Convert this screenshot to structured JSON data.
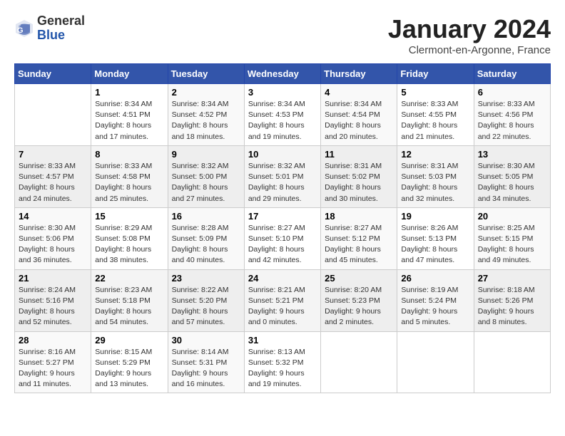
{
  "header": {
    "logo_general": "General",
    "logo_blue": "Blue",
    "month_title": "January 2024",
    "location": "Clermont-en-Argonne, France"
  },
  "weekdays": [
    "Sunday",
    "Monday",
    "Tuesday",
    "Wednesday",
    "Thursday",
    "Friday",
    "Saturday"
  ],
  "weeks": [
    [
      {
        "day": "",
        "sunrise": "",
        "sunset": "",
        "daylight": ""
      },
      {
        "day": "1",
        "sunrise": "Sunrise: 8:34 AM",
        "sunset": "Sunset: 4:51 PM",
        "daylight": "Daylight: 8 hours and 17 minutes."
      },
      {
        "day": "2",
        "sunrise": "Sunrise: 8:34 AM",
        "sunset": "Sunset: 4:52 PM",
        "daylight": "Daylight: 8 hours and 18 minutes."
      },
      {
        "day": "3",
        "sunrise": "Sunrise: 8:34 AM",
        "sunset": "Sunset: 4:53 PM",
        "daylight": "Daylight: 8 hours and 19 minutes."
      },
      {
        "day": "4",
        "sunrise": "Sunrise: 8:34 AM",
        "sunset": "Sunset: 4:54 PM",
        "daylight": "Daylight: 8 hours and 20 minutes."
      },
      {
        "day": "5",
        "sunrise": "Sunrise: 8:33 AM",
        "sunset": "Sunset: 4:55 PM",
        "daylight": "Daylight: 8 hours and 21 minutes."
      },
      {
        "day": "6",
        "sunrise": "Sunrise: 8:33 AM",
        "sunset": "Sunset: 4:56 PM",
        "daylight": "Daylight: 8 hours and 22 minutes."
      }
    ],
    [
      {
        "day": "7",
        "sunrise": "Sunrise: 8:33 AM",
        "sunset": "Sunset: 4:57 PM",
        "daylight": "Daylight: 8 hours and 24 minutes."
      },
      {
        "day": "8",
        "sunrise": "Sunrise: 8:33 AM",
        "sunset": "Sunset: 4:58 PM",
        "daylight": "Daylight: 8 hours and 25 minutes."
      },
      {
        "day": "9",
        "sunrise": "Sunrise: 8:32 AM",
        "sunset": "Sunset: 5:00 PM",
        "daylight": "Daylight: 8 hours and 27 minutes."
      },
      {
        "day": "10",
        "sunrise": "Sunrise: 8:32 AM",
        "sunset": "Sunset: 5:01 PM",
        "daylight": "Daylight: 8 hours and 29 minutes."
      },
      {
        "day": "11",
        "sunrise": "Sunrise: 8:31 AM",
        "sunset": "Sunset: 5:02 PM",
        "daylight": "Daylight: 8 hours and 30 minutes."
      },
      {
        "day": "12",
        "sunrise": "Sunrise: 8:31 AM",
        "sunset": "Sunset: 5:03 PM",
        "daylight": "Daylight: 8 hours and 32 minutes."
      },
      {
        "day": "13",
        "sunrise": "Sunrise: 8:30 AM",
        "sunset": "Sunset: 5:05 PM",
        "daylight": "Daylight: 8 hours and 34 minutes."
      }
    ],
    [
      {
        "day": "14",
        "sunrise": "Sunrise: 8:30 AM",
        "sunset": "Sunset: 5:06 PM",
        "daylight": "Daylight: 8 hours and 36 minutes."
      },
      {
        "day": "15",
        "sunrise": "Sunrise: 8:29 AM",
        "sunset": "Sunset: 5:08 PM",
        "daylight": "Daylight: 8 hours and 38 minutes."
      },
      {
        "day": "16",
        "sunrise": "Sunrise: 8:28 AM",
        "sunset": "Sunset: 5:09 PM",
        "daylight": "Daylight: 8 hours and 40 minutes."
      },
      {
        "day": "17",
        "sunrise": "Sunrise: 8:27 AM",
        "sunset": "Sunset: 5:10 PM",
        "daylight": "Daylight: 8 hours and 42 minutes."
      },
      {
        "day": "18",
        "sunrise": "Sunrise: 8:27 AM",
        "sunset": "Sunset: 5:12 PM",
        "daylight": "Daylight: 8 hours and 45 minutes."
      },
      {
        "day": "19",
        "sunrise": "Sunrise: 8:26 AM",
        "sunset": "Sunset: 5:13 PM",
        "daylight": "Daylight: 8 hours and 47 minutes."
      },
      {
        "day": "20",
        "sunrise": "Sunrise: 8:25 AM",
        "sunset": "Sunset: 5:15 PM",
        "daylight": "Daylight: 8 hours and 49 minutes."
      }
    ],
    [
      {
        "day": "21",
        "sunrise": "Sunrise: 8:24 AM",
        "sunset": "Sunset: 5:16 PM",
        "daylight": "Daylight: 8 hours and 52 minutes."
      },
      {
        "day": "22",
        "sunrise": "Sunrise: 8:23 AM",
        "sunset": "Sunset: 5:18 PM",
        "daylight": "Daylight: 8 hours and 54 minutes."
      },
      {
        "day": "23",
        "sunrise": "Sunrise: 8:22 AM",
        "sunset": "Sunset: 5:20 PM",
        "daylight": "Daylight: 8 hours and 57 minutes."
      },
      {
        "day": "24",
        "sunrise": "Sunrise: 8:21 AM",
        "sunset": "Sunset: 5:21 PM",
        "daylight": "Daylight: 9 hours and 0 minutes."
      },
      {
        "day": "25",
        "sunrise": "Sunrise: 8:20 AM",
        "sunset": "Sunset: 5:23 PM",
        "daylight": "Daylight: 9 hours and 2 minutes."
      },
      {
        "day": "26",
        "sunrise": "Sunrise: 8:19 AM",
        "sunset": "Sunset: 5:24 PM",
        "daylight": "Daylight: 9 hours and 5 minutes."
      },
      {
        "day": "27",
        "sunrise": "Sunrise: 8:18 AM",
        "sunset": "Sunset: 5:26 PM",
        "daylight": "Daylight: 9 hours and 8 minutes."
      }
    ],
    [
      {
        "day": "28",
        "sunrise": "Sunrise: 8:16 AM",
        "sunset": "Sunset: 5:27 PM",
        "daylight": "Daylight: 9 hours and 11 minutes."
      },
      {
        "day": "29",
        "sunrise": "Sunrise: 8:15 AM",
        "sunset": "Sunset: 5:29 PM",
        "daylight": "Daylight: 9 hours and 13 minutes."
      },
      {
        "day": "30",
        "sunrise": "Sunrise: 8:14 AM",
        "sunset": "Sunset: 5:31 PM",
        "daylight": "Daylight: 9 hours and 16 minutes."
      },
      {
        "day": "31",
        "sunrise": "Sunrise: 8:13 AM",
        "sunset": "Sunset: 5:32 PM",
        "daylight": "Daylight: 9 hours and 19 minutes."
      },
      {
        "day": "",
        "sunrise": "",
        "sunset": "",
        "daylight": ""
      },
      {
        "day": "",
        "sunrise": "",
        "sunset": "",
        "daylight": ""
      },
      {
        "day": "",
        "sunrise": "",
        "sunset": "",
        "daylight": ""
      }
    ]
  ]
}
